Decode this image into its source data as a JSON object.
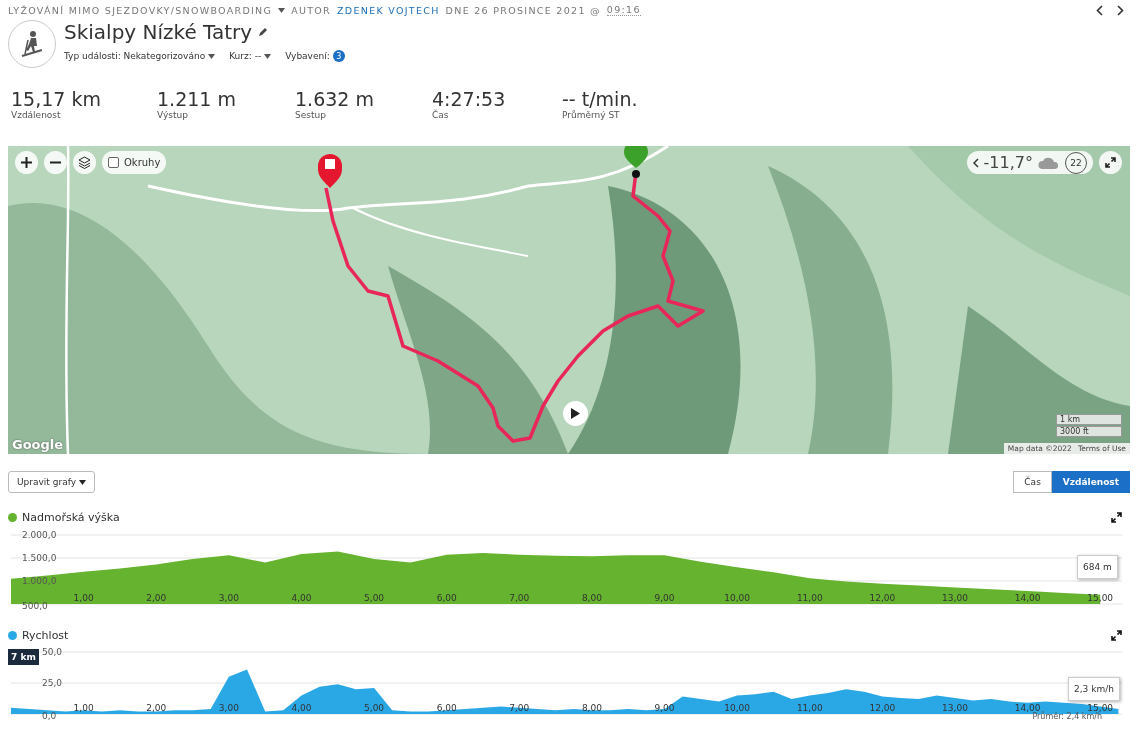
{
  "header": {
    "activity_type": "LYŽOVÁNÍ MIMO SJEZDOVKY/SNOWBOARDING",
    "author_prefix": "AUTOR",
    "author": "ZDENEK VOJTECH",
    "date": "DNE 26 PROSINCE 2021 @",
    "time": "09:16"
  },
  "title": "Skialpy Nízké Tatry",
  "meta": [
    {
      "label": "Typ události: Nekategorizováno",
      "kind": "dropdown"
    },
    {
      "label": "Kurz: --",
      "kind": "dropdown"
    },
    {
      "label": "Vybavení:",
      "kind": "badge",
      "count": "3"
    }
  ],
  "stats": [
    {
      "value": "15,17 km",
      "label": "Vzdálenost"
    },
    {
      "value": "1.211 m",
      "label": "Výstup"
    },
    {
      "value": "1.632 m",
      "label": "Sestup"
    },
    {
      "value": "4:27:53",
      "label": "Čas"
    },
    {
      "value": "-- t/min.",
      "label": "Průměrný ST"
    }
  ],
  "map": {
    "kind": "picture",
    "loops_checkbox": {
      "label": "Okruhy",
      "checked": false
    },
    "weather": {
      "temperature": "-11,7°",
      "wind": "22"
    },
    "logo": "Google",
    "scale": [
      "1 km",
      "3000 ft"
    ],
    "attribution": "Map data ©2022",
    "terms_link": "Terms of Use"
  },
  "edit_charts_button": "Upravit grafy",
  "axis_toggle": [
    {
      "label": "Čas",
      "selected": false
    },
    {
      "label": "Vzdálenost",
      "selected": true
    }
  ],
  "charts": [
    {
      "tooltip": "684 m",
      "chart_data": {
        "type": "area",
        "xlim": [
          0,
          15.3
        ],
        "ylim": [
          500,
          2000
        ],
        "x": [
          0,
          0.5,
          1,
          1.5,
          2,
          2.5,
          3,
          3.5,
          4,
          4.5,
          5,
          5.5,
          6,
          6.5,
          7,
          7.5,
          8,
          8.5,
          9,
          9.5,
          10,
          10.5,
          11,
          11.5,
          12,
          12.5,
          13,
          13.5,
          14,
          14.5,
          15
        ],
        "series": [
          {
            "name": "Nadmořská výška",
            "color": "#65b32e",
            "values": [
              1050,
              1120,
              1200,
              1270,
              1360,
              1480,
              1560,
              1400,
              1590,
              1640,
              1480,
              1400,
              1570,
              1610,
              1570,
              1550,
              1540,
              1560,
              1560,
              1420,
              1300,
              1190,
              1060,
              990,
              940,
              900,
              860,
              820,
              780,
              740,
              700
            ]
          }
        ],
        "yticks": [
          {
            "value": 500,
            "label": "500,0"
          },
          {
            "value": 1000,
            "label": "1.000,0"
          },
          {
            "value": 1500,
            "label": "1.500,0"
          },
          {
            "value": 2000,
            "label": "2.000,0"
          }
        ],
        "xticks": [
          {
            "value": 1,
            "label": "1,00"
          },
          {
            "value": 2,
            "label": "2,00"
          },
          {
            "value": 3,
            "label": "3,00"
          },
          {
            "value": 4,
            "label": "4,00"
          },
          {
            "value": 5,
            "label": "5,00"
          },
          {
            "value": 6,
            "label": "6,00"
          },
          {
            "value": 7,
            "label": "7,00"
          },
          {
            "value": 8,
            "label": "8,00"
          },
          {
            "value": 9,
            "label": "9,00"
          },
          {
            "value": 10,
            "label": "10,00"
          },
          {
            "value": 11,
            "label": "11,00"
          },
          {
            "value": 12,
            "label": "12,00"
          },
          {
            "value": 13,
            "label": "13,00"
          },
          {
            "value": 14,
            "label": "14,00"
          },
          {
            "value": 15,
            "label": "15,00"
          }
        ]
      }
    },
    {
      "tooltip": "2,3 km/h",
      "cursor_label": "7 km",
      "average": "Průměr: 2,4 km/h",
      "chart_data": {
        "type": "area",
        "xlim": [
          0,
          15.3
        ],
        "ylim": [
          0,
          50
        ],
        "x": [
          0,
          0.25,
          0.5,
          0.75,
          1,
          1.25,
          1.5,
          1.75,
          2,
          2.25,
          2.5,
          2.75,
          3,
          3.25,
          3.5,
          3.75,
          4,
          4.25,
          4.5,
          4.75,
          5,
          5.25,
          5.5,
          5.75,
          6,
          6.25,
          6.5,
          6.75,
          7,
          7.25,
          7.5,
          7.75,
          8,
          8.25,
          8.5,
          8.75,
          9,
          9.25,
          9.5,
          9.75,
          10,
          10.25,
          10.5,
          10.75,
          11,
          11.25,
          11.5,
          11.75,
          12,
          12.25,
          12.5,
          12.75,
          13,
          13.25,
          13.5,
          13.75,
          14,
          14.25,
          14.5,
          14.75,
          15,
          15.25
        ],
        "series": [
          {
            "name": "Rychlost",
            "color": "#2aa8e6",
            "values": [
              5,
              4,
              3,
              2,
              3,
              2,
              3,
              2,
              2,
              3,
              3,
              4,
              30,
              36,
              2,
              3,
              15,
              22,
              24,
              20,
              21,
              3,
              2,
              2,
              3,
              4,
              5,
              6,
              5,
              4,
              3,
              4,
              3,
              3,
              4,
              3,
              4,
              14,
              12,
              10,
              15,
              16,
              18,
              12,
              15,
              17,
              20,
              18,
              14,
              13,
              12,
              15,
              13,
              11,
              12,
              10,
              9,
              10,
              9,
              8,
              6,
              4
            ]
          }
        ],
        "yticks": [
          {
            "value": 0,
            "label": "0,0"
          },
          {
            "value": 25,
            "label": "25,0"
          },
          {
            "value": 50,
            "label": "50,0"
          }
        ],
        "xticks": [
          {
            "value": 1,
            "label": "1,00"
          },
          {
            "value": 2,
            "label": "2,00"
          },
          {
            "value": 3,
            "label": "3,00"
          },
          {
            "value": 4,
            "label": "4,00"
          },
          {
            "value": 5,
            "label": "5,00"
          },
          {
            "value": 6,
            "label": "6,00"
          },
          {
            "value": 7,
            "label": "7,00"
          },
          {
            "value": 8,
            "label": "8,00"
          },
          {
            "value": 9,
            "label": "9,00"
          },
          {
            "value": 10,
            "label": "10,00"
          },
          {
            "value": 11,
            "label": "11,00"
          },
          {
            "value": 12,
            "label": "12,00"
          },
          {
            "value": 13,
            "label": "13,00"
          },
          {
            "value": 14,
            "label": "14,00"
          },
          {
            "value": 15,
            "label": "15,00"
          }
        ]
      }
    }
  ]
}
